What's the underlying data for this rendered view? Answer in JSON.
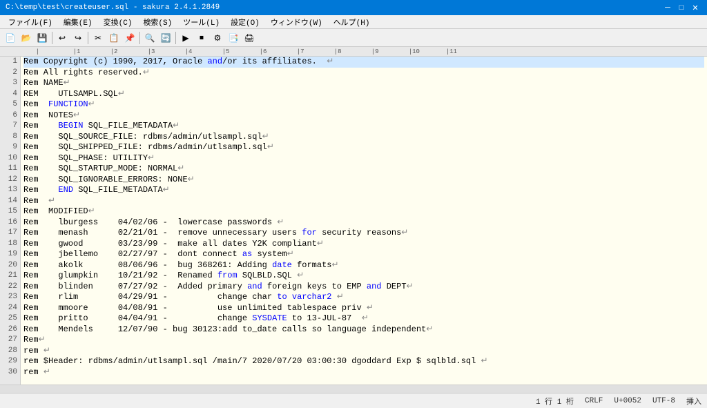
{
  "window": {
    "title": "C:\\temp\\test\\createuser.sql - sakura 2.4.1.2849",
    "controls": [
      "─",
      "□",
      "✕"
    ]
  },
  "menu": {
    "items": [
      "ファイル(F)",
      "編集(E)",
      "変換(C)",
      "検索(S)",
      "ツール(L)",
      "設定(O)",
      "ウィンドウ(W)",
      "ヘルプ(H)"
    ]
  },
  "ruler": {
    "text": "         |         |1        |2        |3        |4        |5        |6        |7        |8        |9        |10       |11"
  },
  "status": {
    "position": "1 行  1 桁",
    "crlf": "CRLF",
    "unicode": "U+0052",
    "encoding": "UTF-8",
    "mode": "挿入"
  },
  "lines": [
    {
      "num": "1",
      "text": "Rem Copyright (c) 1990, 2017, Oracle and/or its affiliates.  ↵",
      "highlight": [
        "and"
      ]
    },
    {
      "num": "2",
      "text": "Rem All rights reserved.↵"
    },
    {
      "num": "3",
      "text": "Rem NAME↵"
    },
    {
      "num": "4",
      "text": "REM    UTLSAMPL.SQL↵"
    },
    {
      "num": "5",
      "text": "Rem  FUNCTION↵",
      "blue_word": "FUNCTION"
    },
    {
      "num": "6",
      "text": "Rem  NOTES↵"
    },
    {
      "num": "7",
      "text": "Rem    BEGIN SQL_FILE_METADATA↵",
      "blue_words": [
        "BEGIN"
      ]
    },
    {
      "num": "8",
      "text": "Rem    SQL_SOURCE_FILE: rdbms/admin/utlsampl.sql↵"
    },
    {
      "num": "9",
      "text": "Rem    SQL_SHIPPED_FILE: rdbms/admin/utlsampl.sql↵"
    },
    {
      "num": "10",
      "text": "Rem    SQL_PHASE: UTILITY↵"
    },
    {
      "num": "11",
      "text": "Rem    SQL_STARTUP_MODE: NORMAL↵"
    },
    {
      "num": "12",
      "text": "Rem    SQL_IGNORABLE_ERRORS: NONE↵"
    },
    {
      "num": "13",
      "text": "Rem    END SQL_FILE_METADATA↵",
      "blue_words": [
        "END"
      ]
    },
    {
      "num": "14",
      "text": "Rem  ↵"
    },
    {
      "num": "15",
      "text": "Rem  MODIFIED↵"
    },
    {
      "num": "16",
      "text": "Rem    lburgess    04/02/06 -  lowercase passwords ↵"
    },
    {
      "num": "17",
      "text": "Rem    menash      02/21/01 -  remove unnecessary users for security reasons↵",
      "blue_words": [
        "for"
      ]
    },
    {
      "num": "18",
      "text": "Rem    gwood       03/23/99 -  make all dates Y2K compliant↵"
    },
    {
      "num": "19",
      "text": "Rem    jbellemo    02/27/97 -  dont connect as system↵",
      "blue_words": [
        "as"
      ]
    },
    {
      "num": "20",
      "text": "Rem    akolk       08/06/96 -  bug 368261: Adding date formats↵",
      "blue_words": [
        "date"
      ]
    },
    {
      "num": "21",
      "text": "Rem    glumpkin    10/21/92 -  Renamed from SQLBLD.SQL ↵",
      "blue_words": [
        "from"
      ]
    },
    {
      "num": "22",
      "text": "Rem    blinden     07/27/92 -  Added primary and foreign keys to EMP and DEPT↵",
      "blue_words": [
        "and",
        "and"
      ]
    },
    {
      "num": "23",
      "text": "Rem    rlim        04/29/91 -          change char to varchar2 ↵",
      "blue_words": [
        "to",
        "varchar2"
      ]
    },
    {
      "num": "24",
      "text": "Rem    mmoore      04/08/91 -          use unlimited tablespace priv ↵"
    },
    {
      "num": "25",
      "text": "Rem    pritto      04/04/91 -          change SYSDATE to 13-JUL-87  ↵",
      "blue_words": [
        "SYSDATE"
      ]
    },
    {
      "num": "26",
      "text": "Rem    Mendels     12/07/90 - bug 30123:add to_date calls so language independent↵"
    },
    {
      "num": "27",
      "text": "Rem↵"
    },
    {
      "num": "28",
      "text": "rem ↵"
    },
    {
      "num": "29",
      "text": "rem $Header: rdbms/admin/utlsampl.sql /main/7 2020/07/20 03:00:30 dgoddard Exp $ sqlbld.sql ↵"
    },
    {
      "num": "30",
      "text": "rem ↵"
    }
  ]
}
